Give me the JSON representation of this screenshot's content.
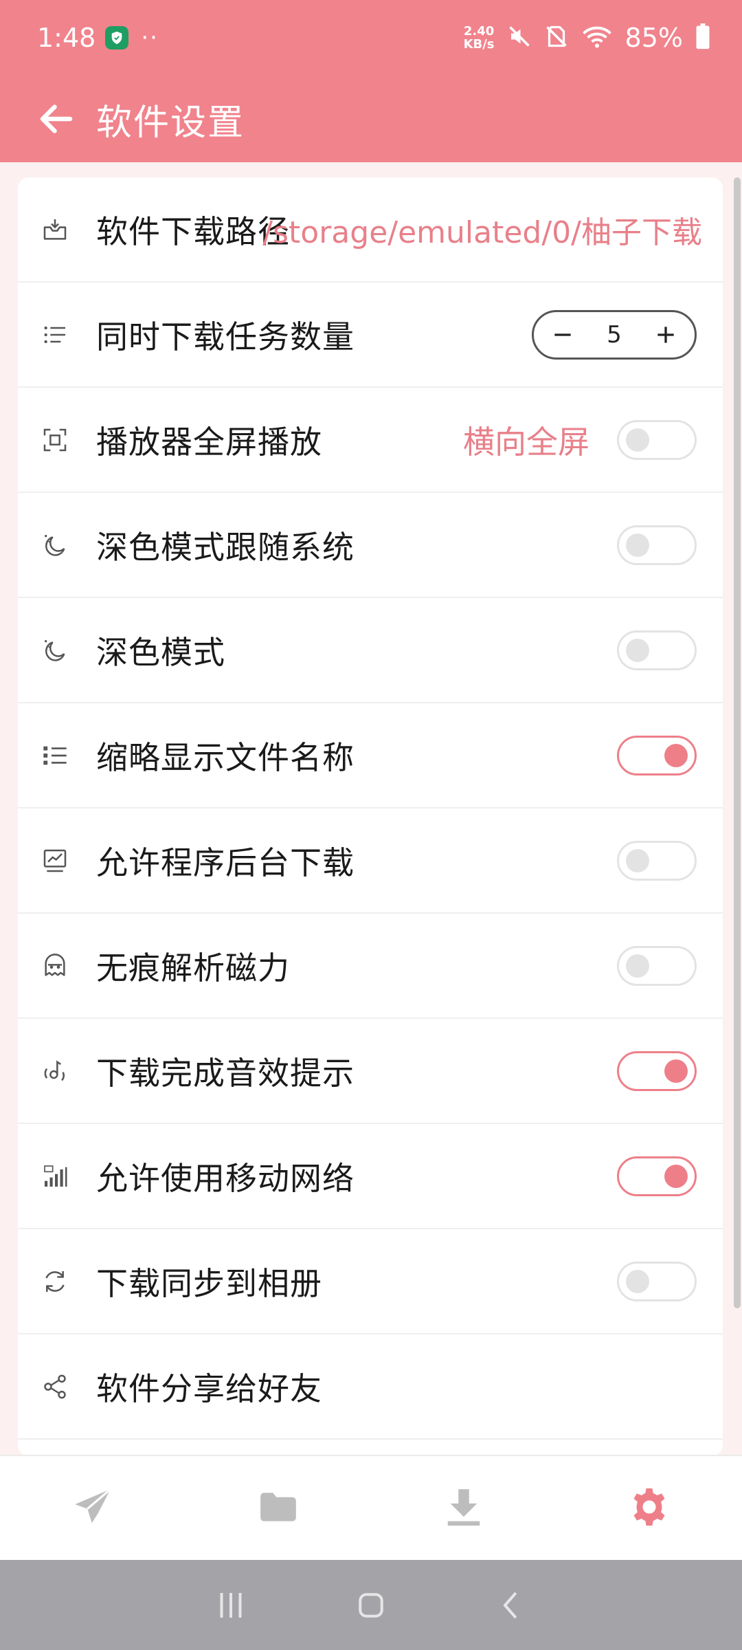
{
  "status_bar": {
    "time": "1:48",
    "dots": "··",
    "net_speed_value": "2.40",
    "net_speed_unit": "KB/s",
    "battery": "85%"
  },
  "app_bar": {
    "title": "软件设置"
  },
  "settings": {
    "download_path": {
      "label": "软件下载路径",
      "value": "/storage/emulated/0/柚子下载",
      "icon": "inbox-download-icon"
    },
    "concurrent_tasks": {
      "label": "同时下载任务数量",
      "value": "5",
      "icon": "list-icon"
    },
    "player_fullscreen": {
      "label": "播放器全屏播放",
      "value": "横向全屏",
      "enabled": false,
      "icon": "fullscreen-icon"
    },
    "dark_follow_system": {
      "label": "深色模式跟随系统",
      "enabled": false,
      "icon": "moon-icon"
    },
    "dark_mode": {
      "label": "深色模式",
      "enabled": false,
      "icon": "moon-icon"
    },
    "abbreviate_filenames": {
      "label": "缩略显示文件名称",
      "enabled": true,
      "icon": "bullet-list-icon"
    },
    "background_download": {
      "label": "允许程序后台下载",
      "enabled": false,
      "icon": "monitor-chart-icon"
    },
    "incognito_magnet": {
      "label": "无痕解析磁力",
      "enabled": false,
      "icon": "incognito-icon"
    },
    "completion_sound": {
      "label": "下载完成音效提示",
      "enabled": true,
      "icon": "sound-icon"
    },
    "mobile_network": {
      "label": "允许使用移动网络",
      "enabled": true,
      "icon": "signal-5g-icon"
    },
    "sync_album": {
      "label": "下载同步到相册",
      "enabled": false,
      "icon": "sync-icon"
    },
    "share_app": {
      "label": "软件分享给好友",
      "icon": "share-icon"
    }
  },
  "bottom_nav": {
    "items": [
      {
        "icon": "paper-plane-icon",
        "active": false
      },
      {
        "icon": "folder-icon",
        "active": false
      },
      {
        "icon": "download-icon",
        "active": false
      },
      {
        "icon": "gear-icon",
        "active": true
      }
    ]
  },
  "colors": {
    "primary": "#F0838C",
    "accent": "#EE7F89",
    "inactive_icon": "#BDBDBD",
    "background": "#FCF0F0"
  }
}
